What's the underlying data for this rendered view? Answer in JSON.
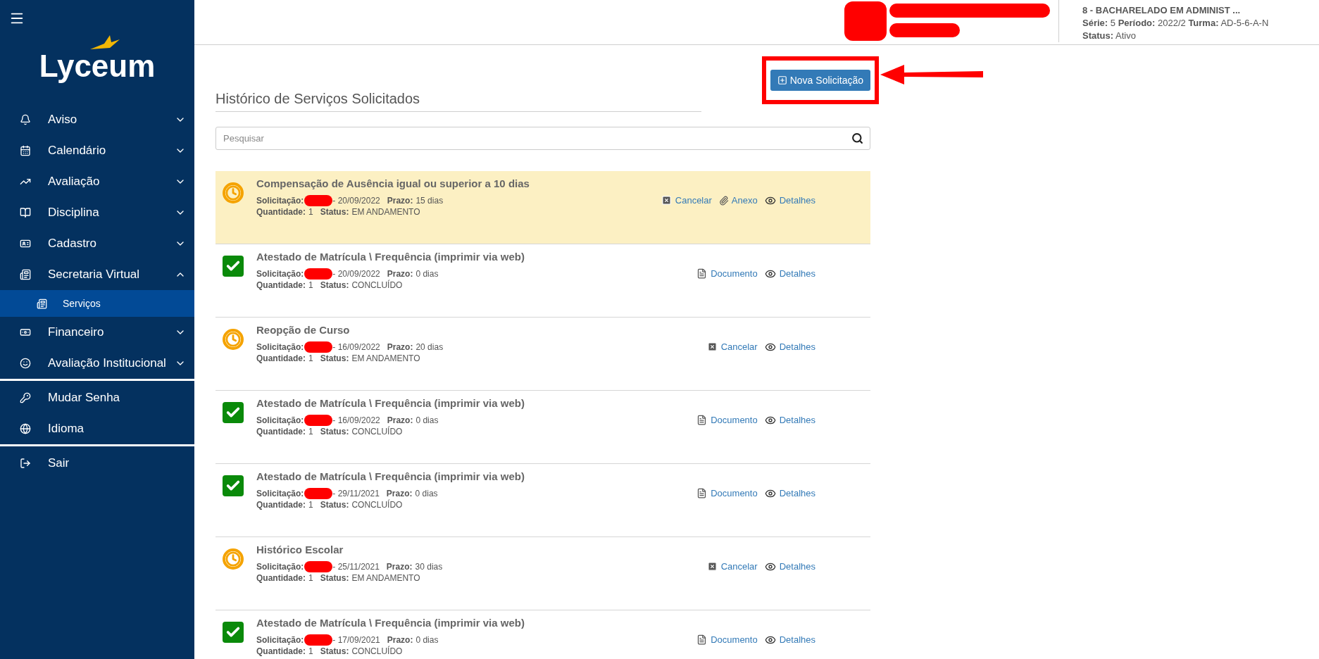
{
  "sidebar": {
    "logo": "Lyceum",
    "groups": [
      [
        {
          "label": "Aviso",
          "expanded": false
        },
        {
          "label": "Calendário",
          "expanded": false
        },
        {
          "label": "Avaliação",
          "expanded": false
        },
        {
          "label": "Disciplina",
          "expanded": false
        },
        {
          "label": "Cadastro",
          "expanded": false
        },
        {
          "label": "Secretaria Virtual",
          "expanded": true,
          "children": [
            {
              "label": "Serviços",
              "selected": true
            }
          ]
        },
        {
          "label": "Financeiro",
          "expanded": false
        },
        {
          "label": "Avaliação Institucional",
          "expanded": false
        }
      ],
      [
        {
          "label": "Mudar Senha"
        },
        {
          "label": "Idioma"
        }
      ],
      [
        {
          "label": "Sair"
        }
      ]
    ]
  },
  "header": {
    "course": "8 - BACHARELADO EM ADMINIST ...",
    "fields": [
      [
        {
          "label": "Série:",
          "value": "5"
        },
        {
          "label": "Período:",
          "value": "2022/2"
        },
        {
          "label": "Turma:",
          "value": "AD-5-6-A-N"
        }
      ],
      [
        {
          "label": "Status:",
          "value": "Ativo"
        }
      ]
    ]
  },
  "new_request_button": "Nova Solicitação",
  "title": "Histórico de Serviços Solicitados",
  "search": {
    "placeholder": "Pesquisar"
  },
  "requests": [
    {
      "kind": "pending",
      "selected": true,
      "title": "Compensação de Ausência igual ou superior a 10 dias",
      "request_label": "Solicitação:",
      "date": "- 20/09/2022",
      "deadline_label": "Prazo:",
      "deadline": "15 dias",
      "quantity_label": "Quantidade:",
      "quantity": "1",
      "status_label": "Status:",
      "status": "EM ANDAMENTO",
      "actions": [
        {
          "kind": "cancel",
          "label": "Cancelar"
        },
        {
          "kind": "attachment",
          "label": "Anexo"
        },
        {
          "kind": "details",
          "label": "Detalhes"
        }
      ]
    },
    {
      "kind": "done",
      "selected": false,
      "title": "Atestado de Matrícula \\ Frequência (imprimir via web)",
      "request_label": "Solicitação:",
      "date": "- 20/09/2022",
      "deadline_label": "Prazo:",
      "deadline": "0 dias",
      "quantity_label": "Quantidade:",
      "quantity": "1",
      "status_label": "Status:",
      "status": "CONCLUÍDO",
      "actions": [
        {
          "kind": "document",
          "label": "Documento"
        },
        {
          "kind": "details",
          "label": "Detalhes"
        }
      ]
    },
    {
      "kind": "pending",
      "selected": false,
      "title": "Reopção de Curso",
      "request_label": "Solicitação:",
      "date": "- 16/09/2022",
      "deadline_label": "Prazo:",
      "deadline": "20 dias",
      "quantity_label": "Quantidade:",
      "quantity": "1",
      "status_label": "Status:",
      "status": "EM ANDAMENTO",
      "actions": [
        {
          "kind": "cancel",
          "label": "Cancelar"
        },
        {
          "kind": "details",
          "label": "Detalhes"
        }
      ]
    },
    {
      "kind": "done",
      "selected": false,
      "title": "Atestado de Matrícula \\ Frequência (imprimir via web)",
      "request_label": "Solicitação:",
      "date": "- 16/09/2022",
      "deadline_label": "Prazo:",
      "deadline": "0 dias",
      "quantity_label": "Quantidade:",
      "quantity": "1",
      "status_label": "Status:",
      "status": "CONCLUÍDO",
      "actions": [
        {
          "kind": "document",
          "label": "Documento"
        },
        {
          "kind": "details",
          "label": "Detalhes"
        }
      ]
    },
    {
      "kind": "done",
      "selected": false,
      "title": "Atestado de Matrícula \\ Frequência (imprimir via web)",
      "request_label": "Solicitação:",
      "date": "- 29/11/2021",
      "deadline_label": "Prazo:",
      "deadline": "0 dias",
      "quantity_label": "Quantidade:",
      "quantity": "1",
      "status_label": "Status:",
      "status": "CONCLUÍDO",
      "actions": [
        {
          "kind": "document",
          "label": "Documento"
        },
        {
          "kind": "details",
          "label": "Detalhes"
        }
      ]
    },
    {
      "kind": "pending",
      "selected": false,
      "title": "Histórico Escolar",
      "request_label": "Solicitação:",
      "date": "- 25/11/2021",
      "deadline_label": "Prazo:",
      "deadline": "30 dias",
      "quantity_label": "Quantidade:",
      "quantity": "1",
      "status_label": "Status:",
      "status": "EM ANDAMENTO",
      "actions": [
        {
          "kind": "cancel",
          "label": "Cancelar"
        },
        {
          "kind": "details",
          "label": "Detalhes"
        }
      ]
    },
    {
      "kind": "done",
      "selected": false,
      "title": "Atestado de Matrícula \\ Frequência (imprimir via web)",
      "request_label": "Solicitação:",
      "date": "- 17/09/2021",
      "deadline_label": "Prazo:",
      "deadline": "0 dias",
      "quantity_label": "Quantidade:",
      "quantity": "1",
      "status_label": "Status:",
      "status": "CONCLUÍDO",
      "actions": [
        {
          "kind": "document",
          "label": "Documento"
        },
        {
          "kind": "details",
          "label": "Detalhes"
        }
      ]
    }
  ]
}
